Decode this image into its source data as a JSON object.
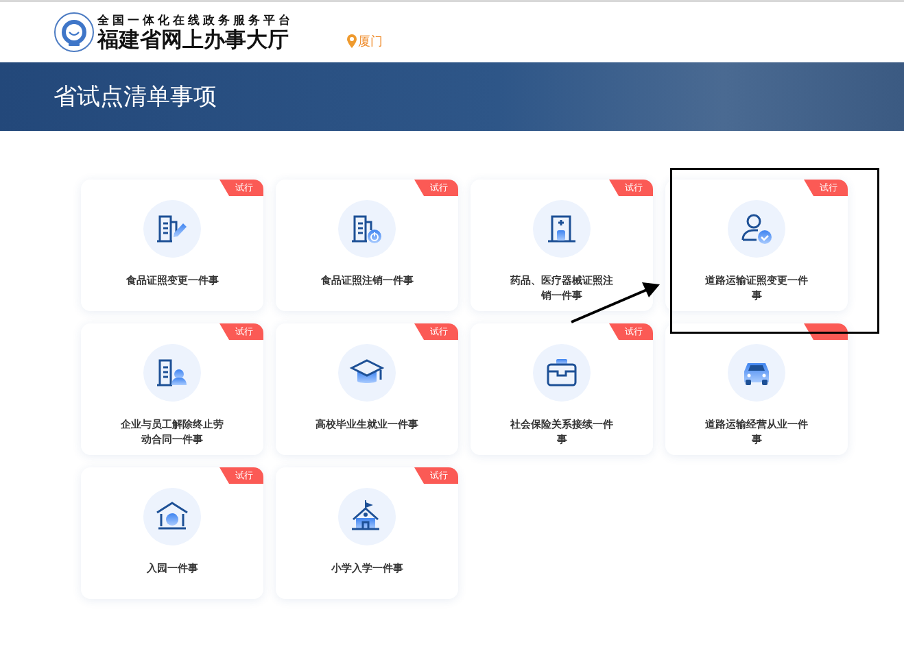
{
  "header": {
    "platform_line": "全国一体化在线政务服务平台",
    "site_title": "福建省网上办事大厅",
    "location": "厦门"
  },
  "banner": {
    "title": "省试点清单事项"
  },
  "items": [
    {
      "title": "食品证照变更一件事",
      "badge": "试行",
      "kind": "doc-pen"
    },
    {
      "title": "食品证照注销一件事",
      "badge": "试行",
      "kind": "doc-power"
    },
    {
      "title": "药品、医疗器械证照注销一件事",
      "badge": "试行",
      "kind": "door"
    },
    {
      "title": "道路运输证照变更一件事",
      "badge": "试行",
      "kind": "user-check"
    },
    {
      "title": "企业与员工解除终止劳动合同一件事",
      "badge": "试行",
      "kind": "doc-user"
    },
    {
      "title": "高校毕业生就业一件事",
      "badge": "试行",
      "kind": "cap"
    },
    {
      "title": "社会保险关系接续一件事",
      "badge": "试行",
      "kind": "briefcase"
    },
    {
      "title": "道路运输经营从业一件事",
      "kind": "car"
    },
    {
      "title": "入园一件事",
      "badge": "试行",
      "kind": "house"
    },
    {
      "title": "小学入学一件事",
      "badge": "试行",
      "kind": "school"
    }
  ]
}
